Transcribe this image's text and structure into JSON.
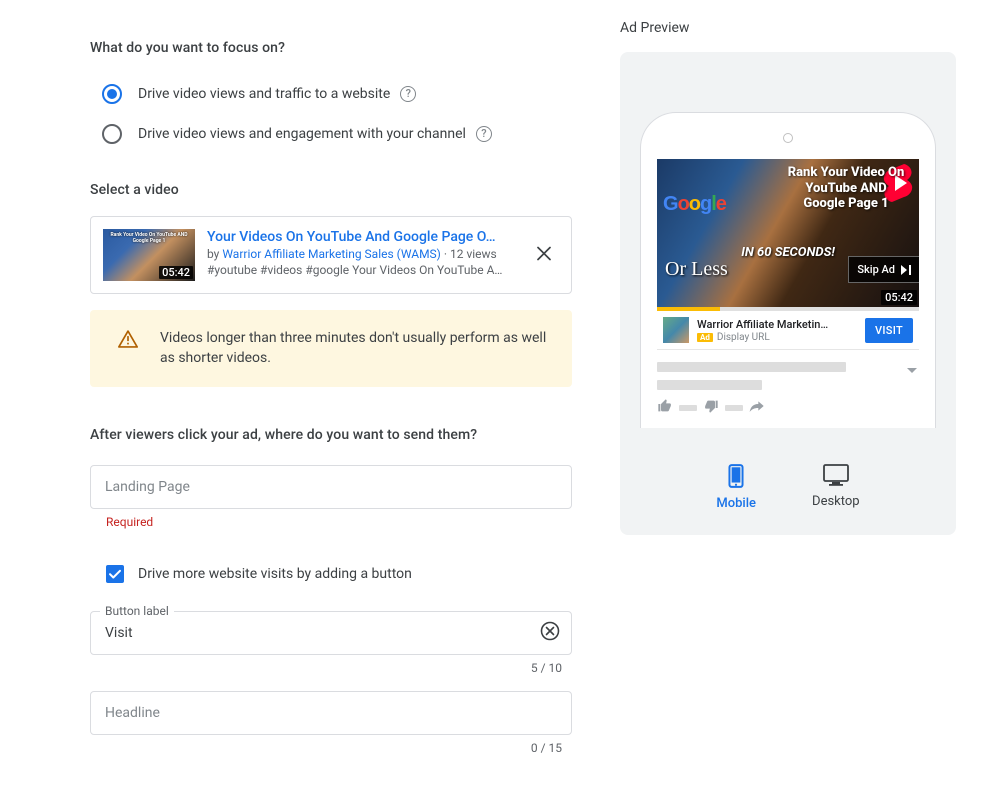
{
  "focus": {
    "heading": "What do you want to focus on?",
    "option1": "Drive video views and traffic to a website",
    "option2": "Drive video views and engagement with your channel",
    "selected": 0
  },
  "select_video": {
    "heading": "Select a video",
    "title": "Your Videos On YouTube And Google Page O…",
    "by": "by",
    "channel": "Warrior Affiliate Marketing Sales (WAMS)",
    "views": "12 views",
    "tags": "#youtube #videos #google Your Videos On YouTube A…",
    "duration": "05:42",
    "thumb_text": "Rank Your Video On YouTube AND Google Page 1"
  },
  "warning": {
    "text": "Videos longer than three minutes don't usually perform as well as shorter videos."
  },
  "destination": {
    "heading": "After viewers click your ad, where do you want to send them?",
    "landing_placeholder": "Landing Page",
    "landing_value": "",
    "required": "Required",
    "checkbox_label": "Drive more website visits by adding a button",
    "button_field_label": "Button label",
    "button_value": "Visit",
    "button_counter": "5 / 10",
    "headline_placeholder": "Headline",
    "headline_value": "",
    "headline_counter": "0 / 15"
  },
  "preview": {
    "title": "Ad Preview",
    "overlay_line1": "Rank Your Video On",
    "overlay_line2": "YouTube AND",
    "overlay_line3": "Google Page 1",
    "overlay_sub": "IN 60 SECONDS!",
    "overlay_sub2": "Or Less",
    "skip": "Skip Ad",
    "duration": "05:42",
    "channel": "Warrior Affiliate Marketin…",
    "ad_badge": "Ad",
    "display_url": "Display URL",
    "cta": "VISIT",
    "device_mobile": "Mobile",
    "device_desktop": "Desktop"
  }
}
